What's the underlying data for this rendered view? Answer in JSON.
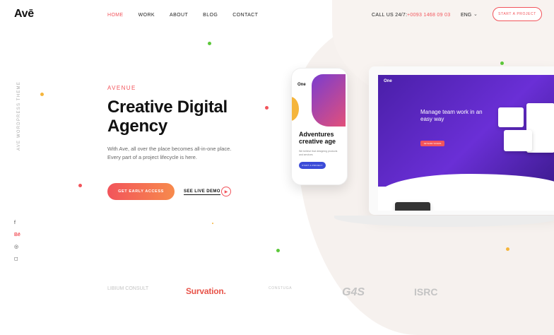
{
  "header": {
    "logo": "Avē",
    "nav": [
      "HOME",
      "WORK",
      "ABOUT",
      "BLOG",
      "CONTACT"
    ],
    "call_label": "CALL US 24/7:",
    "phone": "+0093 1468 09 03",
    "lang": "ENG",
    "start_button": "START A PROJECT"
  },
  "side": {
    "vertical_text": "AVE WORDPRESS THEME",
    "social": [
      "f",
      "Bē",
      "◎",
      "◻"
    ]
  },
  "hero": {
    "eyebrow": "AVENUE",
    "title": "Creative Digital Agency",
    "description": "With Ave, all over the place becomes all-in-one place. Every part of a project lifecycle is here.",
    "cta": "GET EARLY ACCESS",
    "demo": "SEE LIVE DEMO"
  },
  "mockups": {
    "laptop_logo": "One",
    "laptop_title": "Manage team work in an easy way",
    "laptop_button": "GET EARLY ACCESS",
    "phone_logo": "One",
    "phone_title": "Adventures creative age",
    "phone_text": "We believe that designing products and services",
    "phone_button": "START A PROJECT"
  },
  "brands": [
    "LIBIUM CONSULT",
    "Survation.",
    "CONSTUGA",
    "G4S",
    "ISRC"
  ],
  "colors": {
    "accent": "#f2545b",
    "purple": "#5a26c4",
    "green": "#5cc83a",
    "yellow": "#f5b53c"
  }
}
